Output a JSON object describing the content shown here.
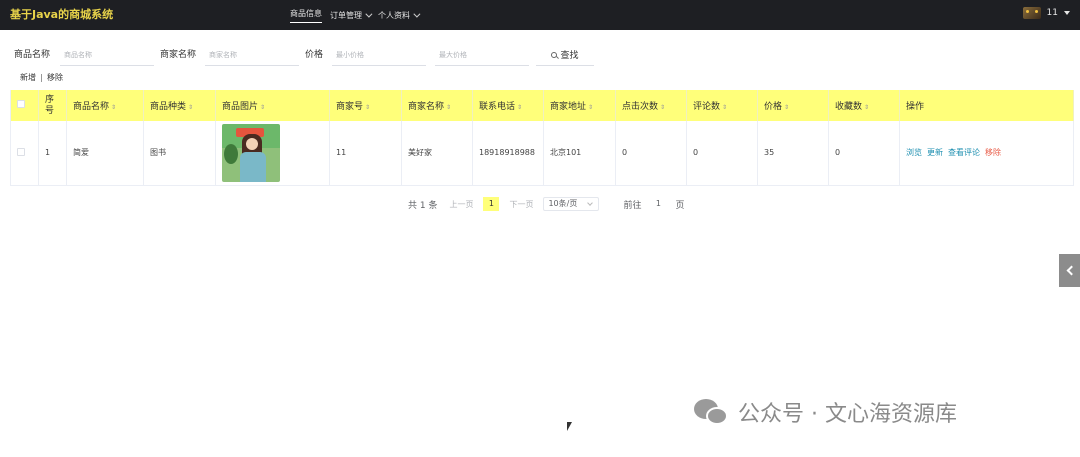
{
  "app": {
    "title": "基于Java的商城系统"
  },
  "nav": {
    "items": [
      {
        "label": "商品信息"
      },
      {
        "label": "订单管理"
      },
      {
        "label": "个人资料"
      }
    ],
    "user_name": "11"
  },
  "search": {
    "name_label": "商品名称",
    "name_placeholder": "商品名称",
    "merchant_label": "商家名称",
    "merchant_placeholder": "商家名称",
    "price_label": "价格",
    "min_placeholder": "最小价格",
    "max_placeholder": "最大价格",
    "button_label": "查找"
  },
  "actions": {
    "add": "新增",
    "remove": "移除"
  },
  "table": {
    "headers": [
      "序号",
      "商品名称",
      "商品种类",
      "商品图片",
      "商家号",
      "商家名称",
      "联系电话",
      "商家地址",
      "点击次数",
      "评论数",
      "价格",
      "收藏数",
      "操作"
    ],
    "rows": [
      {
        "index": "1",
        "name": "简爱",
        "category": "图书",
        "merchant_no": "11",
        "merchant_name": "美好家",
        "phone": "18918918988",
        "address": "北京101",
        "clicks": "0",
        "comments": "0",
        "price": "35",
        "favorites": "0",
        "ops": [
          "浏览",
          "更新",
          "查看评论",
          "移除"
        ]
      }
    ]
  },
  "pagination": {
    "total": "共 1 条",
    "prev": "上一页",
    "current": "1",
    "next": "下一页",
    "page_size": "10条/页",
    "goto_label": "前往",
    "goto_value": "1",
    "page_unit": "页"
  },
  "watermark": "公众号 · 文心海资源库"
}
